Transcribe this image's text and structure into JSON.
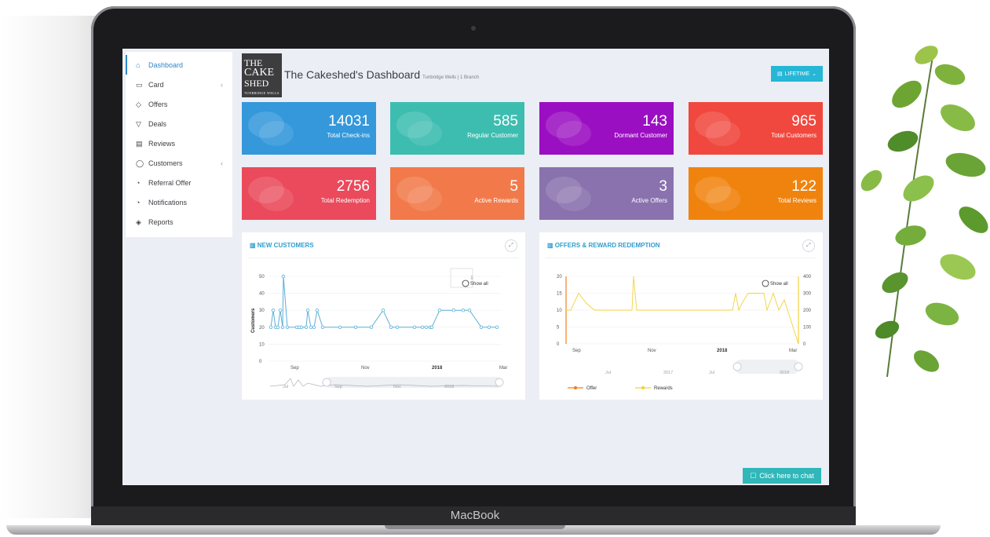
{
  "device": {
    "brand": "MacBook"
  },
  "sidebar": {
    "items": [
      {
        "label": "Dashboard",
        "icon": "home-icon",
        "active": true
      },
      {
        "label": "Card",
        "icon": "card-icon",
        "has_submenu": true
      },
      {
        "label": "Offers",
        "icon": "tag-icon"
      },
      {
        "label": "Deals",
        "icon": "cart-icon"
      },
      {
        "label": "Reviews",
        "icon": "comment-icon"
      },
      {
        "label": "Customers",
        "icon": "user-icon",
        "has_submenu": true
      },
      {
        "label": "Referral Offer",
        "icon": "bell-icon"
      },
      {
        "label": "Notifications",
        "icon": "bell-icon"
      },
      {
        "label": "Reports",
        "icon": "layers-icon"
      }
    ],
    "submenu_chevron": "‹"
  },
  "header": {
    "logo": {
      "line1": "THE",
      "line2": "CAKE",
      "line3": "SHED",
      "line4": "TUNBRIDGE WELLS"
    },
    "title": "The Cakeshed's Dashboard",
    "subtitle": "Tunbridge Wells | 1 Branch",
    "period_button": "LIFETIME"
  },
  "stats": [
    {
      "value": "14031",
      "label": "Total Check-ins",
      "color": "#3498db"
    },
    {
      "value": "585",
      "label": "Regular Customer",
      "color": "#3dbdb0"
    },
    {
      "value": "143",
      "label": "Dormant Customer",
      "color": "#9b0fc2"
    },
    {
      "value": "965",
      "label": "Total Customers",
      "color": "#f0483e"
    },
    {
      "value": "2756",
      "label": "Total Redemption",
      "color": "#ea4a5b"
    },
    {
      "value": "5",
      "label": "Active Rewards",
      "color": "#f27a4a"
    },
    {
      "value": "3",
      "label": "Active Offers",
      "color": "#8a72ae"
    },
    {
      "value": "122",
      "label": "Total Reviews",
      "color": "#f0830e"
    }
  ],
  "panels": {
    "new_customers": {
      "title": "NEW CUSTOMERS",
      "show_all": "Show all"
    },
    "redemption": {
      "title": "OFFERS & REWARD REDEMPTION",
      "show_all": "Show all"
    }
  },
  "chart_data": [
    {
      "type": "line",
      "title": "NEW CUSTOMERS",
      "xlabel": "",
      "ylabel": "Customers",
      "ylim": [
        0,
        50
      ],
      "yticks": [
        0,
        10,
        20,
        30,
        40,
        50
      ],
      "x_tick_labels": [
        "Sep",
        "Nov",
        "2018",
        "Mar"
      ],
      "navigator_labels": [
        "Jul",
        "Sep",
        "Nov",
        "2018"
      ],
      "series": [
        {
          "color": "#5aaed8",
          "values": [
            20,
            30,
            20,
            20,
            30,
            20,
            50,
            20,
            20,
            20,
            20,
            20,
            30,
            20,
            20,
            30,
            20,
            20,
            20,
            20,
            30,
            20,
            20,
            20,
            20,
            20,
            20,
            20,
            30,
            30,
            30,
            30,
            20,
            20,
            20
          ]
        }
      ]
    },
    {
      "type": "line",
      "title": "OFFERS & REWARD REDEMPTION",
      "ylim": [
        0,
        20
      ],
      "yticks": [
        0,
        5,
        10,
        15,
        20
      ],
      "y2lim": [
        0,
        400
      ],
      "y2ticks": [
        0,
        100,
        200,
        300,
        400
      ],
      "x_tick_labels": [
        "Sep",
        "Nov",
        "2018",
        "Mar"
      ],
      "navigator_labels": [
        "Jul",
        "2017",
        "Jul",
        "2018"
      ],
      "series": [
        {
          "name": "Offer",
          "color": "#f4801f",
          "values": []
        },
        {
          "name": "Rewards",
          "color": "#f3d23b",
          "values": [
            10,
            10,
            15,
            12,
            10,
            10,
            10,
            10,
            10,
            10,
            20,
            10,
            10,
            10,
            10,
            10,
            10,
            10,
            10,
            10,
            10,
            10,
            10,
            10,
            15,
            10,
            12,
            15,
            15,
            15,
            10,
            15,
            10,
            13,
            0
          ]
        }
      ]
    }
  ],
  "chat_button": "Click here to chat"
}
